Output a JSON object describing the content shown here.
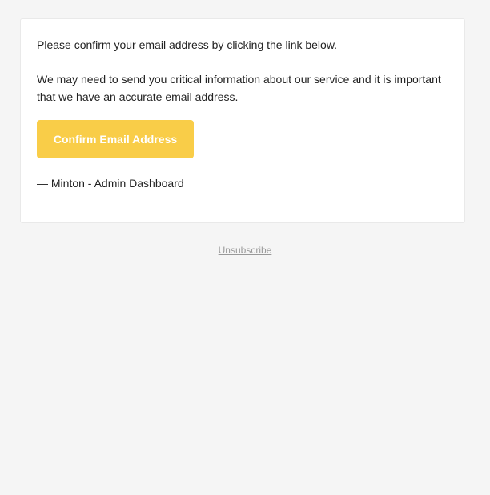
{
  "email": {
    "paragraph_1": "Please confirm your email address by clicking the link below.",
    "paragraph_2": "We may need to send you critical information about our service and it is important that we have an accurate email address.",
    "confirm_button_label": "Confirm Email Address",
    "signature": "— Minton - Admin Dashboard"
  },
  "footer": {
    "unsubscribe_label": "Unsubscribe"
  },
  "colors": {
    "page_background": "#f5f5f5",
    "card_background": "#ffffff",
    "button_background": "#f9cd48",
    "button_text": "#ffffff",
    "body_text": "#222222",
    "footer_link": "#999999"
  }
}
